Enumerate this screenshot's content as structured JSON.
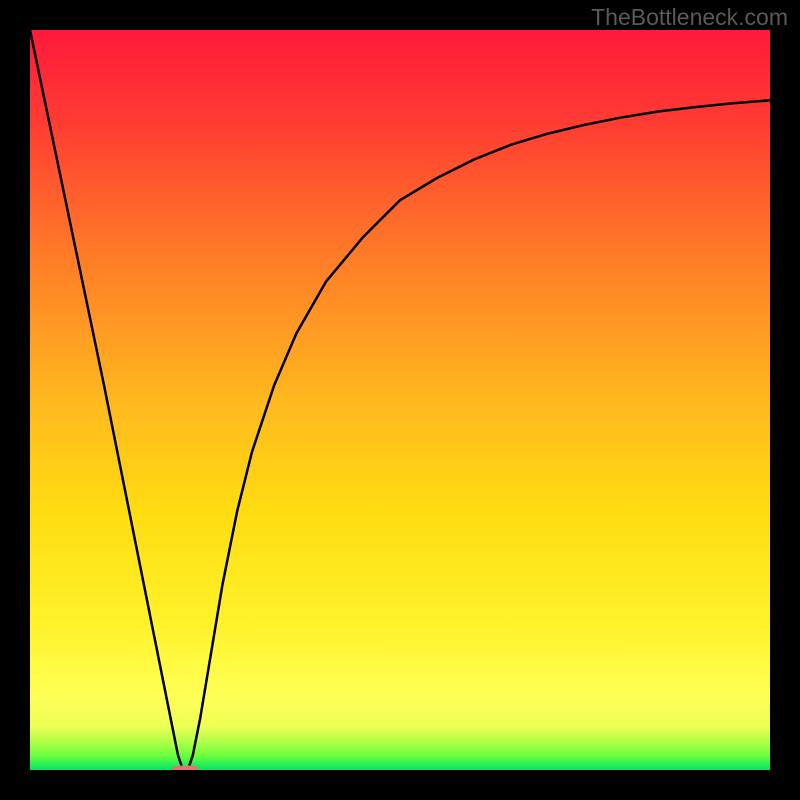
{
  "watermark": "TheBottleneck.com",
  "chart_data": {
    "type": "line",
    "title": "",
    "xlabel": "",
    "ylabel": "",
    "xlim": [
      0,
      100
    ],
    "ylim": [
      0,
      100
    ],
    "grid": false,
    "background_gradient": {
      "top": "#ff1a3b",
      "mid_upper": "#ff8a26",
      "mid": "#ffd400",
      "mid_lower": "#ffff4a",
      "green_band": "#6eff3e",
      "bottom": "#00e565"
    },
    "series": [
      {
        "name": "bottleneck-curve",
        "type": "line",
        "color": "#000000",
        "x": [
          0,
          5,
          10,
          15,
          18,
          20,
          20.5,
          21,
          21.5,
          22,
          23,
          24,
          26,
          28,
          30,
          33,
          36,
          40,
          45,
          50,
          55,
          60,
          65,
          70,
          75,
          80,
          85,
          90,
          95,
          100
        ],
        "y_pct": [
          100,
          76,
          52,
          27,
          12,
          2,
          0.5,
          0,
          0.5,
          2,
          7,
          13,
          25,
          35,
          43,
          52,
          59,
          66,
          72,
          77,
          80,
          82.5,
          84.5,
          86,
          87.2,
          88.2,
          89,
          89.6,
          90.1,
          90.5
        ]
      },
      {
        "name": "optimal-marker",
        "type": "marker",
        "shape": "rounded-rect",
        "color": "#e0776e",
        "x": 21,
        "y_pct": 0,
        "width_pct": 3.5,
        "height_pct": 1.2
      }
    ]
  }
}
